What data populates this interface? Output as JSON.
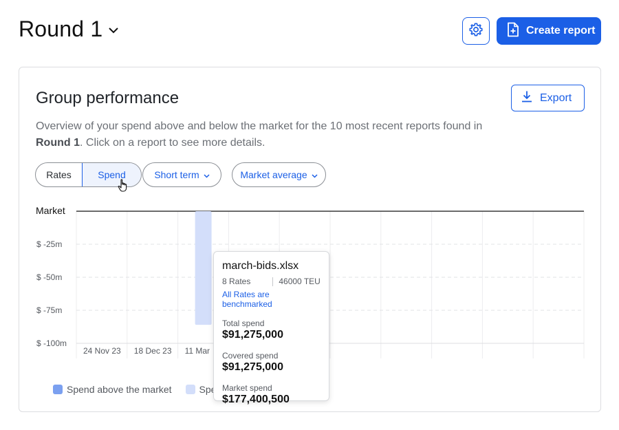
{
  "header": {
    "title": "Round 1",
    "settings_icon": "gear-icon",
    "create_report_label": "Create report"
  },
  "card": {
    "title": "Group performance",
    "export_label": "Export",
    "description_pre": "Overview of your spend above and below the market for the 10 most recent reports found in ",
    "description_bold": "Round 1",
    "description_post": ". Click on a report to see more details."
  },
  "filters": {
    "toggle_rates": "Rates",
    "toggle_spend": "Spend",
    "selected": "Spend",
    "term": "Short term",
    "benchmark": "Market average"
  },
  "chart_data": {
    "type": "bar",
    "ylabel": "",
    "y_tick_labels": [
      "Market",
      "$ -25m",
      "$ -50m",
      "$ -75m",
      "$ -100m"
    ],
    "y_ticks": [
      0,
      -25,
      -50,
      -75,
      -100
    ],
    "ylim": [
      -100,
      0
    ],
    "x_tick_labels": [
      "24 Nov 23",
      "18 Dec 23",
      "11 Mar"
    ],
    "slots": 10,
    "grid": true,
    "series": [
      {
        "name": "Spend above the market",
        "color": "#7ba0f0",
        "values": []
      },
      {
        "name": "Spend below the market",
        "color": "#d3defa",
        "values": [
          {
            "slot": 2,
            "value": -86
          }
        ]
      }
    ],
    "legend_placement": "bottom-left"
  },
  "legend": {
    "items": [
      {
        "label": "Spend above the market",
        "color": "#7ba0f0"
      },
      {
        "label": "Spe",
        "color": "#d3defa"
      }
    ]
  },
  "tooltip": {
    "file_name": "march-bids.xlsx",
    "rates": "8 Rates",
    "teu": "46000 TEU",
    "benchmark_status": "All Rates are benchmarked",
    "total_spend_label": "Total spend",
    "total_spend_value": "$91,275,000",
    "covered_spend_label": "Covered spend",
    "covered_spend_value": "$91,275,000",
    "market_spend_label": "Market spend",
    "market_spend_value": "$177,400,500"
  }
}
